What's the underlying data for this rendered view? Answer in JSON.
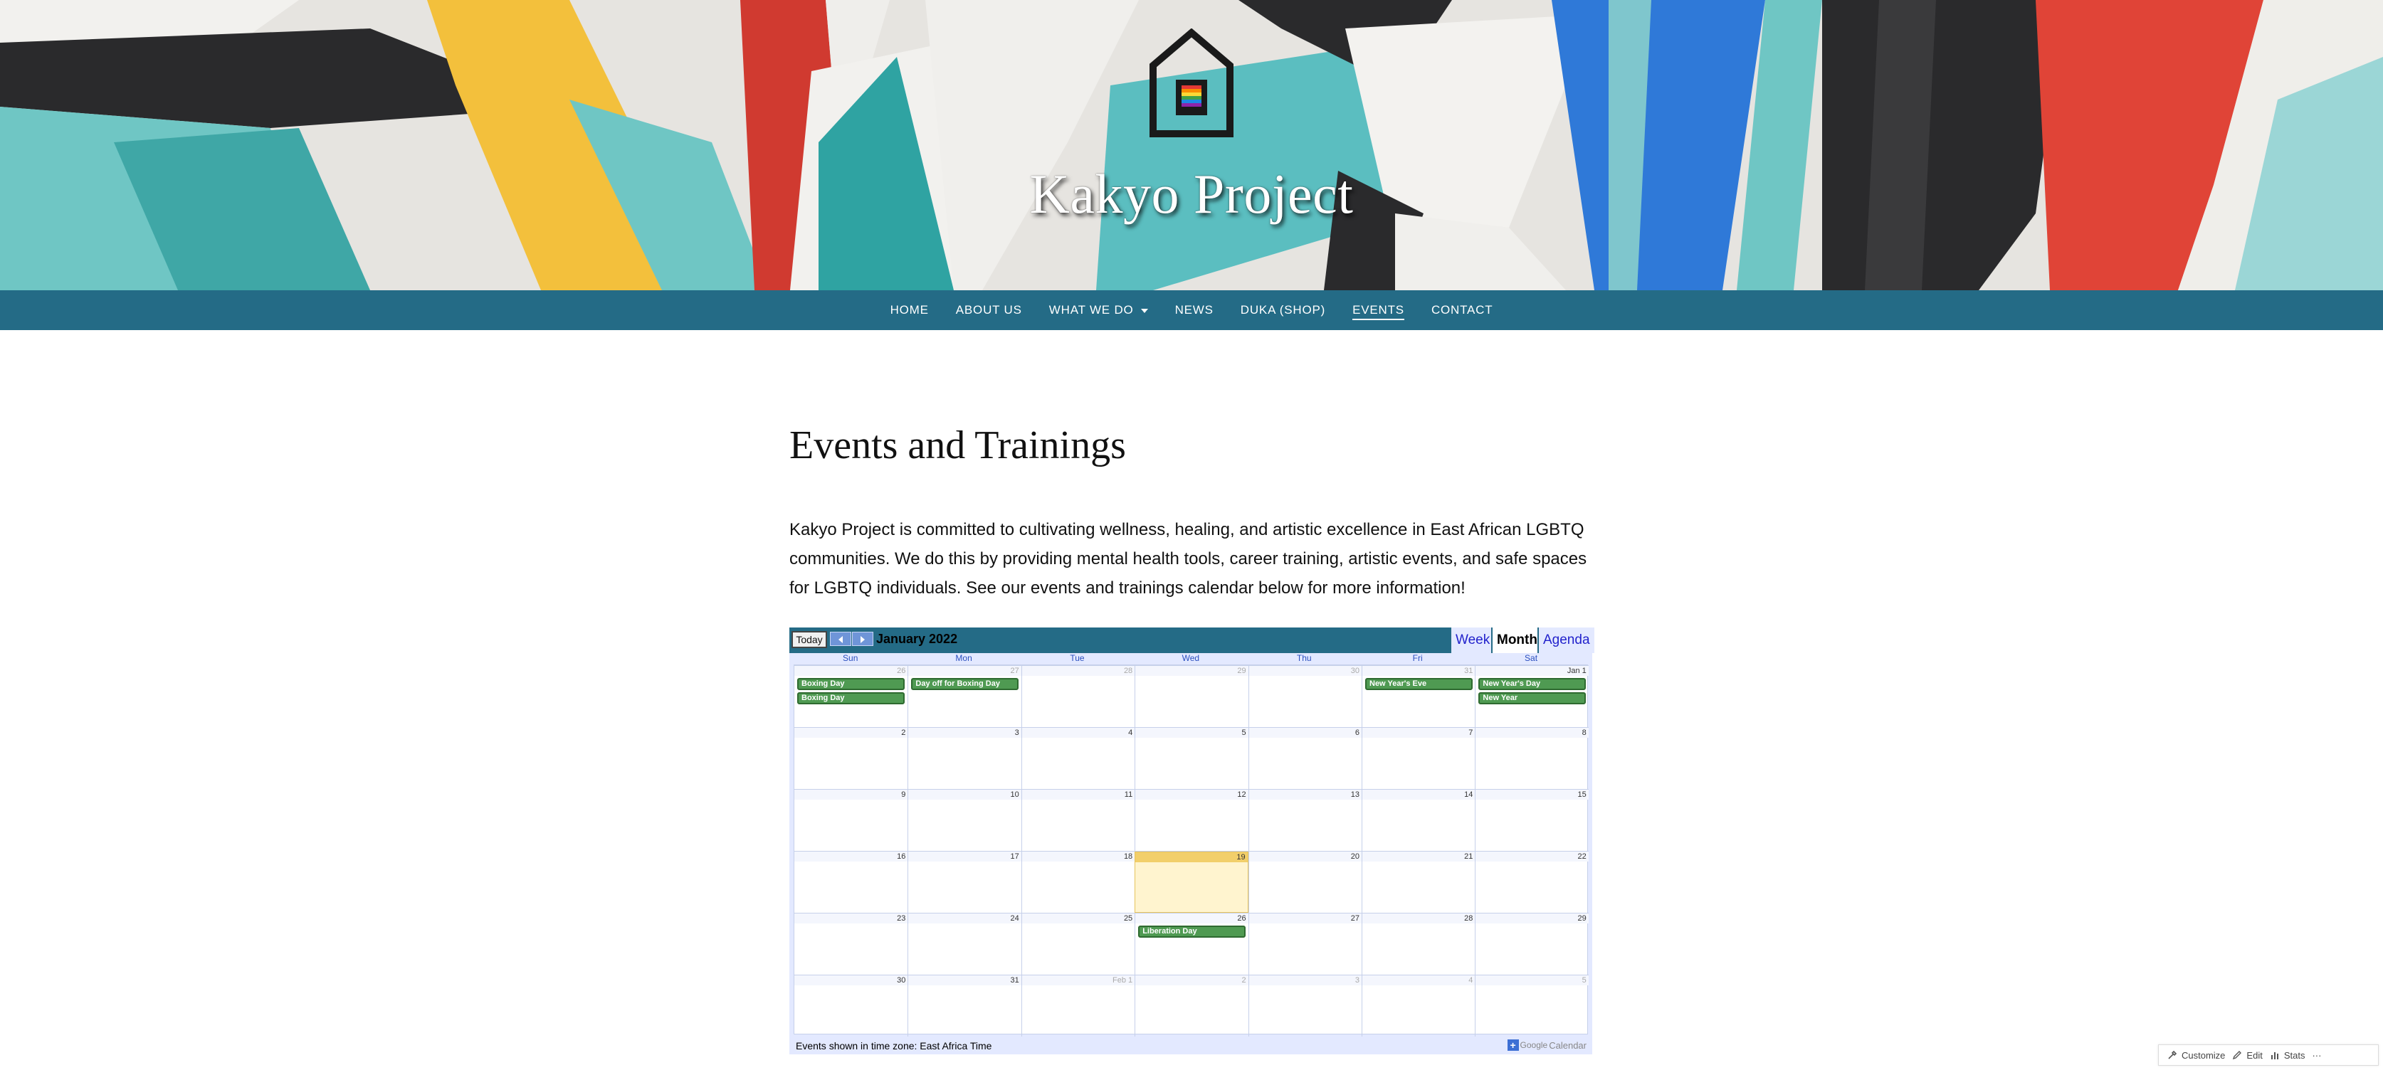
{
  "site": {
    "title": "Kakyo Project"
  },
  "nav": {
    "items": [
      {
        "label": "HOME"
      },
      {
        "label": "ABOUT US"
      },
      {
        "label": "WHAT WE DO"
      },
      {
        "label": "NEWS"
      },
      {
        "label": "DUKA (SHOP)"
      },
      {
        "label": "EVENTS"
      },
      {
        "label": "CONTACT"
      }
    ],
    "current": "EVENTS"
  },
  "page": {
    "title": "Events and Trainings",
    "intro": "Kakyo Project is committed to cultivating wellness, healing, and artistic excellence in East African LGBTQ communities. We do this by providing mental health tools, career training, artistic events, and safe spaces for LGBTQ individuals. See our events and trainings calendar below for more information!"
  },
  "calendar": {
    "today_label": "Today",
    "month_label": "January 2022",
    "views": {
      "week": "Week",
      "month": "Month",
      "agenda": "Agenda"
    },
    "weekdays": [
      "Sun",
      "Mon",
      "Tue",
      "Wed",
      "Thu",
      "Fri",
      "Sat"
    ],
    "weeks": [
      [
        "26",
        "27",
        "28",
        "29",
        "30",
        "31",
        "Jan 1"
      ],
      [
        "2",
        "3",
        "4",
        "5",
        "6",
        "7",
        "8"
      ],
      [
        "9",
        "10",
        "11",
        "12",
        "13",
        "14",
        "15"
      ],
      [
        "16",
        "17",
        "18",
        "19",
        "20",
        "21",
        "22"
      ],
      [
        "23",
        "24",
        "25",
        "26",
        "27",
        "28",
        "29"
      ],
      [
        "30",
        "31",
        "Feb 1",
        "2",
        "3",
        "4",
        "5"
      ]
    ],
    "events": {
      "boxing_day_1": "Boxing Day",
      "boxing_day_2": "Boxing Day",
      "day_off_boxing": "Day off for Boxing Day",
      "new_years_eve": "New Year's Eve",
      "new_years_day": "New Year's Day",
      "new_year": "New Year",
      "liberation_day": "Liberation Day"
    },
    "timezone_note": "Events shown in time zone: East Africa Time",
    "brand_google": "Google",
    "brand_calendar": "Calendar"
  },
  "admin_bar": {
    "customize": "Customize",
    "edit": "Edit",
    "stats": "Stats",
    "more": "···"
  },
  "colors": {
    "nav_bg": "#246b86",
    "event_green": "#4f9a52",
    "today_bg": "#fff4cf"
  }
}
